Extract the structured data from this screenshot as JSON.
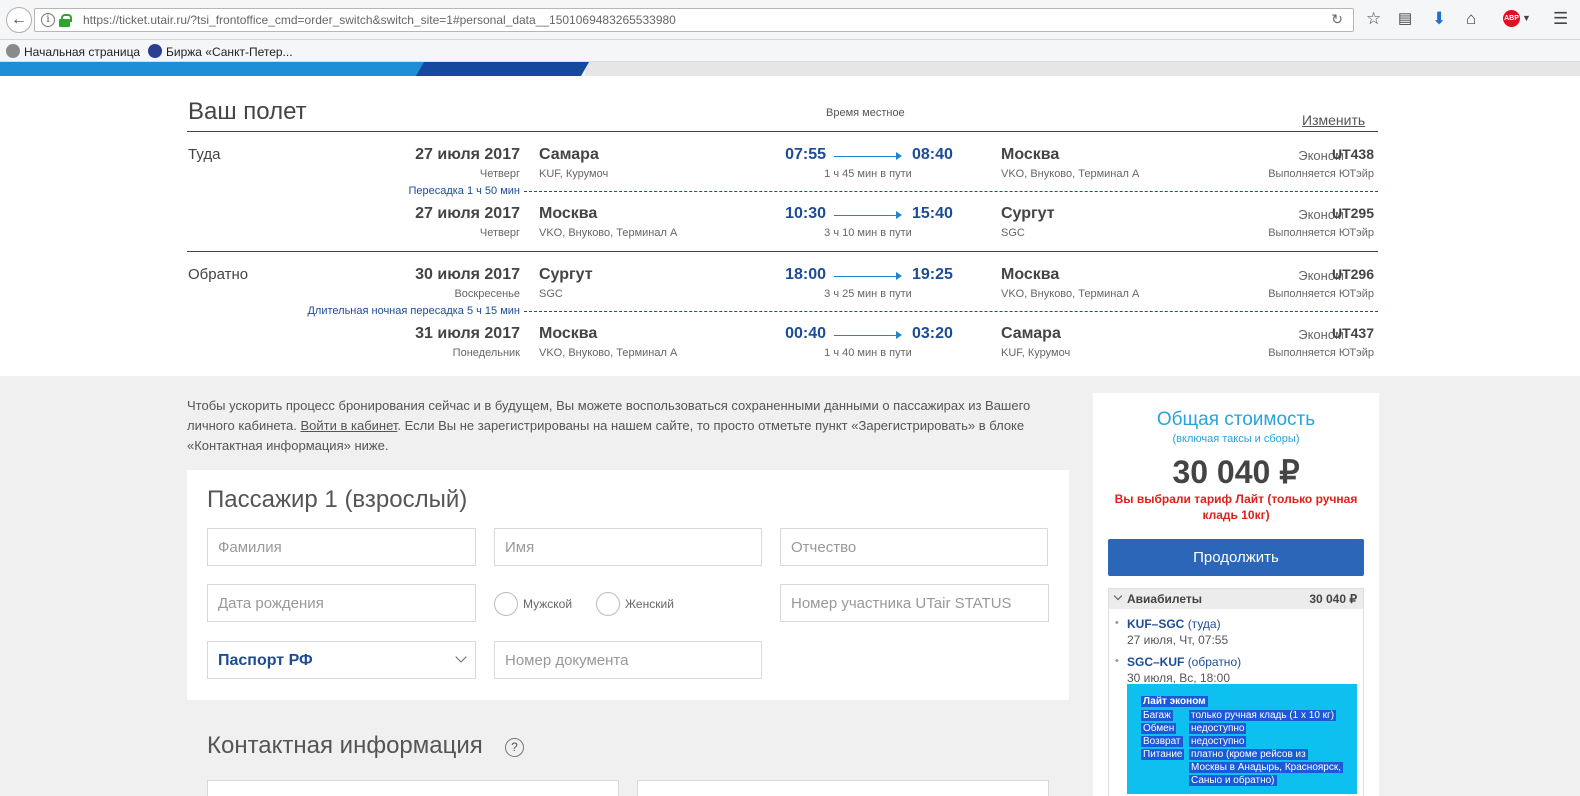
{
  "browser": {
    "url": "https://ticket.utair.ru/?tsi_frontoffice_cmd=order_switch&switch_site=1#personal_data__1501069483265533980",
    "bookmarks": [
      "Начальная страница",
      "Биржа «Санкт-Петер..."
    ]
  },
  "flight": {
    "title": "Ваш полет",
    "local_time_note": "Время местное",
    "change_label": "Изменить",
    "segments": [
      {
        "direction": "Туда",
        "date": "27 июля 2017",
        "weekday": "Четверг",
        "from_city": "Самара",
        "from_airport": "KUF, Курумоч",
        "dep_time": "07:55",
        "arr_time": "08:40",
        "duration": "1 ч 45 мин в пути",
        "to_city": "Москва",
        "to_airport": "VKO, Внуково, Терминал А",
        "fare": "Эконом",
        "flight_no": "UT438",
        "operator": "Выполняется ЮТэйр"
      },
      {
        "direction": "",
        "date": "27 июля 2017",
        "weekday": "Четверг",
        "from_city": "Москва",
        "from_airport": "VKO, Внуково, Терминал А",
        "dep_time": "10:30",
        "arr_time": "15:40",
        "duration": "3 ч 10 мин в пути",
        "to_city": "Сургут",
        "to_airport": "SGC",
        "fare": "Эконом",
        "flight_no": "UT295",
        "operator": "Выполняется ЮТэйр"
      },
      {
        "direction": "Обратно",
        "date": "30 июля 2017",
        "weekday": "Воскресенье",
        "from_city": "Сургут",
        "from_airport": "SGC",
        "dep_time": "18:00",
        "arr_time": "19:25",
        "duration": "3 ч 25 мин в пути",
        "to_city": "Москва",
        "to_airport": "VKO, Внуково, Терминал А",
        "fare": "Эконом",
        "flight_no": "UT296",
        "operator": "Выполняется ЮТэйр"
      },
      {
        "direction": "",
        "date": "31 июля 2017",
        "weekday": "Понедельник",
        "from_city": "Москва",
        "from_airport": "VKO, Внуково, Терминал А",
        "dep_time": "00:40",
        "arr_time": "03:20",
        "duration": "1 ч 40 мин в пути",
        "to_city": "Самара",
        "to_airport": "KUF, Курумоч",
        "fare": "Эконом",
        "flight_no": "UT437",
        "operator": "Выполняется ЮТэйр"
      }
    ],
    "transfers": [
      "Пересадка 1 ч 50 мин",
      "Длительная ночная пересадка 5 ч 15 мин"
    ]
  },
  "info": {
    "text_1": "Чтобы ускорить процесс бронирования сейчас и в будущем, Вы можете воспользоваться сохраненными данными о пассажирах из Вашего личного кабинета. ",
    "link": "Войти в кабинет",
    "text_2": ". Если Вы не зарегистрированы на нашем сайте, то просто отметьте пункт «Зарегистрировать» в блоке «Контактная информация» ниже."
  },
  "passenger": {
    "title": "Пассажир 1 (взрослый)",
    "surname_placeholder": "Фамилия",
    "name_placeholder": "Имя",
    "patronymic_placeholder": "Отчество",
    "birthdate_placeholder": "Дата рождения",
    "male_label": "Мужской",
    "female_label": "Женский",
    "status_placeholder": "Номер участника UTair STATUS",
    "doc_type": "Паспорт РФ",
    "doc_number_placeholder": "Номер документа"
  },
  "contact": {
    "title": "Контактная информация"
  },
  "price": {
    "title": "Общая стоимость",
    "subtitle": "(включая таксы и сборы)",
    "amount": "30 040 ₽",
    "tariff_note": "Вы выбрали тариф Лайт (только ручная кладь 10кг)",
    "continue_label": "Продолжить",
    "tickets_label": "Авиабилеты",
    "tickets_total": "30 040 ₽",
    "routes": [
      {
        "code": "KUF–SGC",
        "dir": "(туда)",
        "date": "27 июля, Чт, 07:55"
      },
      {
        "code": "SGC–KUF",
        "dir": "(обратно)",
        "date": "30 июля, Вс, 18:00"
      }
    ],
    "fare_details": {
      "title": "Лайт эконом",
      "rows": [
        {
          "k": "Багаж",
          "v": "только ручная кладь (1 x 10 кг)"
        },
        {
          "k": "Обмен",
          "v": "недоступно"
        },
        {
          "k": "Возврат",
          "v": "недоступно"
        },
        {
          "k": "Питание",
          "v": "платно (кроме рейсов из"
        }
      ],
      "extra": [
        "Москвы в Анадырь, Красноярск,",
        "Саныо и обратно)"
      ]
    }
  },
  "colors": {
    "brand_blue": "#1c4c96",
    "accent_cyan": "#29a3dd",
    "alert_red": "#e0201a",
    "button_blue": "#2b66b8"
  }
}
